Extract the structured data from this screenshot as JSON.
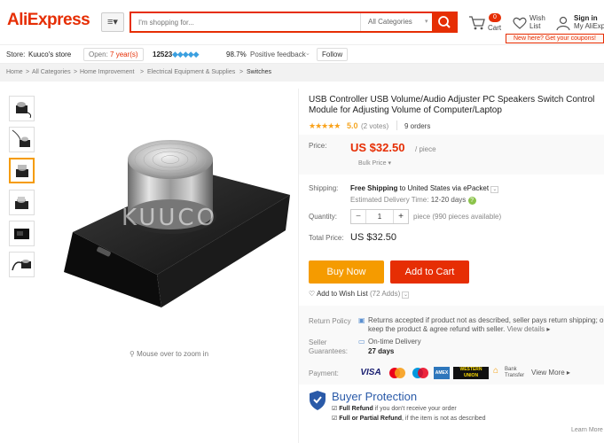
{
  "header": {
    "logo": "AliExpress",
    "search_placeholder": "I'm shopping for...",
    "category": "All Categories",
    "cart_count": "0",
    "cart_label": "Cart",
    "wish_line1": "Wish",
    "wish_line2": "List",
    "signin_line1": "Sign in",
    "signin_line2": "My AliExp",
    "promo": "New here? Get your coupons!"
  },
  "store": {
    "label": "Store:",
    "name": "Kuuco's store",
    "open_prefix": "Open:",
    "open_years": "7 year(s)",
    "score": "12523",
    "feedback_pct": "98.7%",
    "feedback_label": "Positive feedback",
    "follow": "Follow"
  },
  "breadcrumbs": [
    "Home",
    "All Categories",
    "Home Improvement",
    "Electrical Equipment & Supplies",
    "Switches"
  ],
  "gallery": {
    "zoom_hint": "Mouse over to zoom in",
    "watermark": "KUUCO"
  },
  "product": {
    "title": "USB Controller USB Volume/Audio Adjuster PC Speakers Switch Control Module for Adjusting Volume of Computer/Laptop",
    "rating": "5.0",
    "votes": "(2 votes)",
    "orders": "9 orders",
    "price_label": "Price:",
    "price": "US $32.50",
    "per_piece": "/ piece",
    "bulk_price": "Bulk Price",
    "shipping_label": "Shipping:",
    "shipping_free": "Free Shipping",
    "shipping_to": "to",
    "shipping_country": "United States",
    "shipping_via": "via ePacket",
    "delivery_label": "Estimated Delivery Time:",
    "delivery_time": "12-20 days",
    "quantity_label": "Quantity:",
    "quantity": "1",
    "available": "piece (990 pieces available)",
    "total_label": "Total Price:",
    "total": "US $32.50",
    "buy_now": "Buy Now",
    "add_to_cart": "Add to Cart",
    "wishlist": "Add to Wish List",
    "wishlist_count": "(72 Adds)"
  },
  "policy": {
    "return_label": "Return Policy",
    "return_line1": "Returns accepted if product not as described, seller pays return shipping; or",
    "return_line2": "keep the product & agree refund with seller.",
    "view_details": "View details",
    "seller_label1": "Seller",
    "seller_label2": "Guarantees:",
    "ontime": "On-time Delivery",
    "ontime_days": "27 days",
    "payment_label": "Payment:",
    "payments": [
      "VISA",
      "MasterCard",
      "Maestro",
      "AMEX",
      "WESTERN UNION",
      "Bank Transfer"
    ],
    "view_more": "View More"
  },
  "buyer_protection": {
    "title": "Buyer Protection",
    "line1_bold": "Full Refund",
    "line1_rest": "if you don't receive your order",
    "line2_bold": "Full or Partial Refund",
    "line2_rest": ", if the item is not as described",
    "learn_more": "Learn More"
  },
  "colors": {
    "brand": "#e62e04",
    "buy_now": "#f59b00",
    "link_blue": "#2a5aa8",
    "star": "#f9a21b"
  }
}
